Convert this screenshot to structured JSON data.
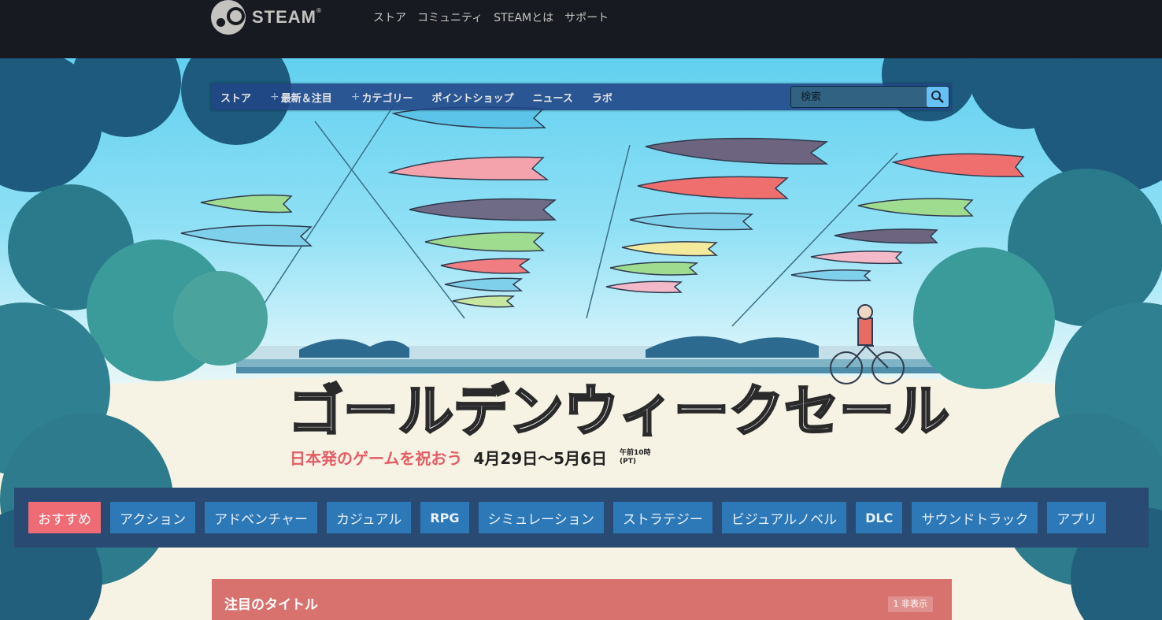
{
  "header": {
    "logo_text": "STEAM",
    "logo_mark": "®",
    "nav": [
      "ストア",
      "コミュニティ",
      "STEAMとは",
      "サポート"
    ]
  },
  "store_nav": {
    "items": [
      {
        "label": "ストア",
        "plus": false
      },
      {
        "label": "最新＆注目",
        "plus": true
      },
      {
        "label": "カテゴリー",
        "plus": true
      },
      {
        "label": "ポイントショップ",
        "plus": false
      },
      {
        "label": "ニュース",
        "plus": false
      },
      {
        "label": "ラボ",
        "plus": false
      }
    ],
    "search_placeholder": "検索",
    "search_icon": "magnifier-icon"
  },
  "sale": {
    "title": "ゴールデンウィークセール",
    "tagline": "日本発のゲームを祝おう",
    "dates": "4月29日〜5月6日",
    "time_line1": "午前10時",
    "time_line2": "(PT)"
  },
  "tabs": [
    {
      "label": "おすすめ",
      "active": true
    },
    {
      "label": "アクション",
      "active": false
    },
    {
      "label": "アドベンチャー",
      "active": false
    },
    {
      "label": "カジュアル",
      "active": false
    },
    {
      "label": "RPG",
      "active": false
    },
    {
      "label": "シミュレーション",
      "active": false
    },
    {
      "label": "ストラテジー",
      "active": false
    },
    {
      "label": "ビジュアルノベル",
      "active": false
    },
    {
      "label": "DLC",
      "active": false
    },
    {
      "label": "サウンドトラック",
      "active": false
    },
    {
      "label": "アプリ",
      "active": false
    }
  ],
  "featured": {
    "title": "注目のタイトル",
    "badge": "1 非表示"
  },
  "colors": {
    "header_bg": "#171a21",
    "store_nav_bg": "#214686",
    "tab_bg": "#2d78b7",
    "tab_active_bg": "#f06c74",
    "tabs_bar_bg": "#294a73",
    "featured_bg": "#d8726e",
    "tagline": "#e45c64"
  }
}
